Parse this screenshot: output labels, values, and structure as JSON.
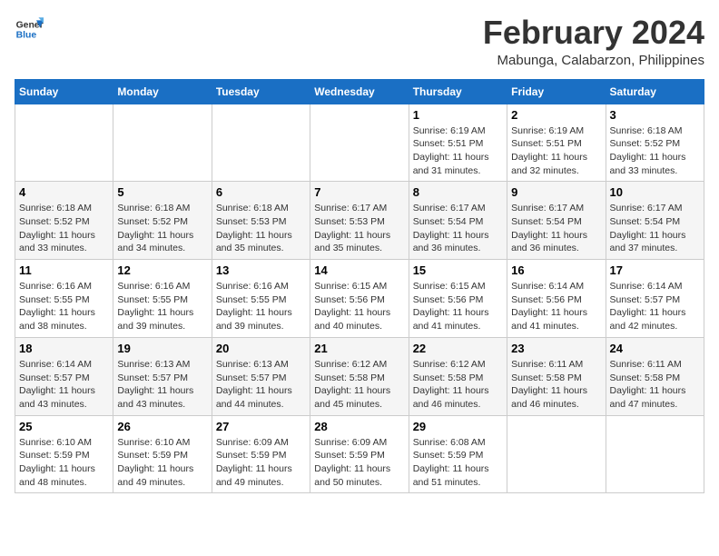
{
  "header": {
    "logo": {
      "line1": "General",
      "line2": "Blue"
    },
    "title": "February 2024",
    "location": "Mabunga, Calabarzon, Philippines"
  },
  "days_of_week": [
    "Sunday",
    "Monday",
    "Tuesday",
    "Wednesday",
    "Thursday",
    "Friday",
    "Saturday"
  ],
  "weeks": [
    [
      {
        "date": "",
        "info": ""
      },
      {
        "date": "",
        "info": ""
      },
      {
        "date": "",
        "info": ""
      },
      {
        "date": "",
        "info": ""
      },
      {
        "date": "1",
        "info": "Sunrise: 6:19 AM\nSunset: 5:51 PM\nDaylight: 11 hours and 31 minutes."
      },
      {
        "date": "2",
        "info": "Sunrise: 6:19 AM\nSunset: 5:51 PM\nDaylight: 11 hours and 32 minutes."
      },
      {
        "date": "3",
        "info": "Sunrise: 6:18 AM\nSunset: 5:52 PM\nDaylight: 11 hours and 33 minutes."
      }
    ],
    [
      {
        "date": "4",
        "info": "Sunrise: 6:18 AM\nSunset: 5:52 PM\nDaylight: 11 hours and 33 minutes."
      },
      {
        "date": "5",
        "info": "Sunrise: 6:18 AM\nSunset: 5:52 PM\nDaylight: 11 hours and 34 minutes."
      },
      {
        "date": "6",
        "info": "Sunrise: 6:18 AM\nSunset: 5:53 PM\nDaylight: 11 hours and 35 minutes."
      },
      {
        "date": "7",
        "info": "Sunrise: 6:17 AM\nSunset: 5:53 PM\nDaylight: 11 hours and 35 minutes."
      },
      {
        "date": "8",
        "info": "Sunrise: 6:17 AM\nSunset: 5:54 PM\nDaylight: 11 hours and 36 minutes."
      },
      {
        "date": "9",
        "info": "Sunrise: 6:17 AM\nSunset: 5:54 PM\nDaylight: 11 hours and 36 minutes."
      },
      {
        "date": "10",
        "info": "Sunrise: 6:17 AM\nSunset: 5:54 PM\nDaylight: 11 hours and 37 minutes."
      }
    ],
    [
      {
        "date": "11",
        "info": "Sunrise: 6:16 AM\nSunset: 5:55 PM\nDaylight: 11 hours and 38 minutes."
      },
      {
        "date": "12",
        "info": "Sunrise: 6:16 AM\nSunset: 5:55 PM\nDaylight: 11 hours and 39 minutes."
      },
      {
        "date": "13",
        "info": "Sunrise: 6:16 AM\nSunset: 5:55 PM\nDaylight: 11 hours and 39 minutes."
      },
      {
        "date": "14",
        "info": "Sunrise: 6:15 AM\nSunset: 5:56 PM\nDaylight: 11 hours and 40 minutes."
      },
      {
        "date": "15",
        "info": "Sunrise: 6:15 AM\nSunset: 5:56 PM\nDaylight: 11 hours and 41 minutes."
      },
      {
        "date": "16",
        "info": "Sunrise: 6:14 AM\nSunset: 5:56 PM\nDaylight: 11 hours and 41 minutes."
      },
      {
        "date": "17",
        "info": "Sunrise: 6:14 AM\nSunset: 5:57 PM\nDaylight: 11 hours and 42 minutes."
      }
    ],
    [
      {
        "date": "18",
        "info": "Sunrise: 6:14 AM\nSunset: 5:57 PM\nDaylight: 11 hours and 43 minutes."
      },
      {
        "date": "19",
        "info": "Sunrise: 6:13 AM\nSunset: 5:57 PM\nDaylight: 11 hours and 43 minutes."
      },
      {
        "date": "20",
        "info": "Sunrise: 6:13 AM\nSunset: 5:57 PM\nDaylight: 11 hours and 44 minutes."
      },
      {
        "date": "21",
        "info": "Sunrise: 6:12 AM\nSunset: 5:58 PM\nDaylight: 11 hours and 45 minutes."
      },
      {
        "date": "22",
        "info": "Sunrise: 6:12 AM\nSunset: 5:58 PM\nDaylight: 11 hours and 46 minutes."
      },
      {
        "date": "23",
        "info": "Sunrise: 6:11 AM\nSunset: 5:58 PM\nDaylight: 11 hours and 46 minutes."
      },
      {
        "date": "24",
        "info": "Sunrise: 6:11 AM\nSunset: 5:58 PM\nDaylight: 11 hours and 47 minutes."
      }
    ],
    [
      {
        "date": "25",
        "info": "Sunrise: 6:10 AM\nSunset: 5:59 PM\nDaylight: 11 hours and 48 minutes."
      },
      {
        "date": "26",
        "info": "Sunrise: 6:10 AM\nSunset: 5:59 PM\nDaylight: 11 hours and 49 minutes."
      },
      {
        "date": "27",
        "info": "Sunrise: 6:09 AM\nSunset: 5:59 PM\nDaylight: 11 hours and 49 minutes."
      },
      {
        "date": "28",
        "info": "Sunrise: 6:09 AM\nSunset: 5:59 PM\nDaylight: 11 hours and 50 minutes."
      },
      {
        "date": "29",
        "info": "Sunrise: 6:08 AM\nSunset: 5:59 PM\nDaylight: 11 hours and 51 minutes."
      },
      {
        "date": "",
        "info": ""
      },
      {
        "date": "",
        "info": ""
      }
    ]
  ]
}
